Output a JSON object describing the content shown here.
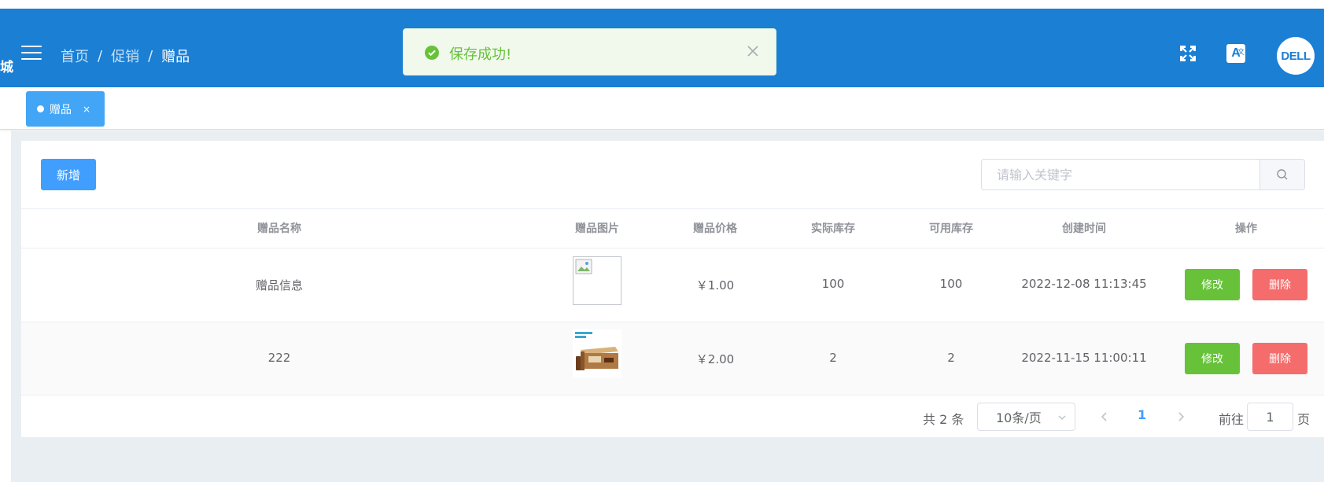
{
  "header": {
    "logo_fragment": "城",
    "breadcrumb": [
      "首页",
      "促销",
      "赠品"
    ],
    "breadcrumb_sep": "/",
    "translate_label": "A",
    "translate_sub": "文",
    "avatar_text": "DELL"
  },
  "toast": {
    "message": "保存成功!"
  },
  "tags": {
    "active_label": "赠品",
    "close_glyph": "×"
  },
  "toolbar": {
    "add_label": "新增",
    "search_placeholder": "请输入关键字"
  },
  "table": {
    "columns": [
      "赠品名称",
      "赠品图片",
      "赠品价格",
      "实际库存",
      "可用库存",
      "创建时间",
      "操作"
    ],
    "rows": [
      {
        "name": "赠品信息",
        "image": "broken",
        "price": "￥1.00",
        "actual_stock": "100",
        "available_stock": "100",
        "created": "2022-12-08 11:13:45",
        "edit_label": "修改",
        "delete_label": "删除"
      },
      {
        "name": "222",
        "image": "product-box",
        "price": "￥2.00",
        "actual_stock": "2",
        "available_stock": "2",
        "created": "2022-11-15 11:00:11",
        "edit_label": "修改",
        "delete_label": "删除"
      }
    ]
  },
  "pagination": {
    "total_text": "共 2 条",
    "page_size": "10条/页",
    "current_page": "1",
    "goto_prefix": "前往",
    "goto_value": "1",
    "goto_suffix": "页"
  },
  "colors": {
    "header": "#1b7fd4",
    "primary": "#409eff",
    "success": "#67c23a",
    "danger": "#f56c6c"
  }
}
